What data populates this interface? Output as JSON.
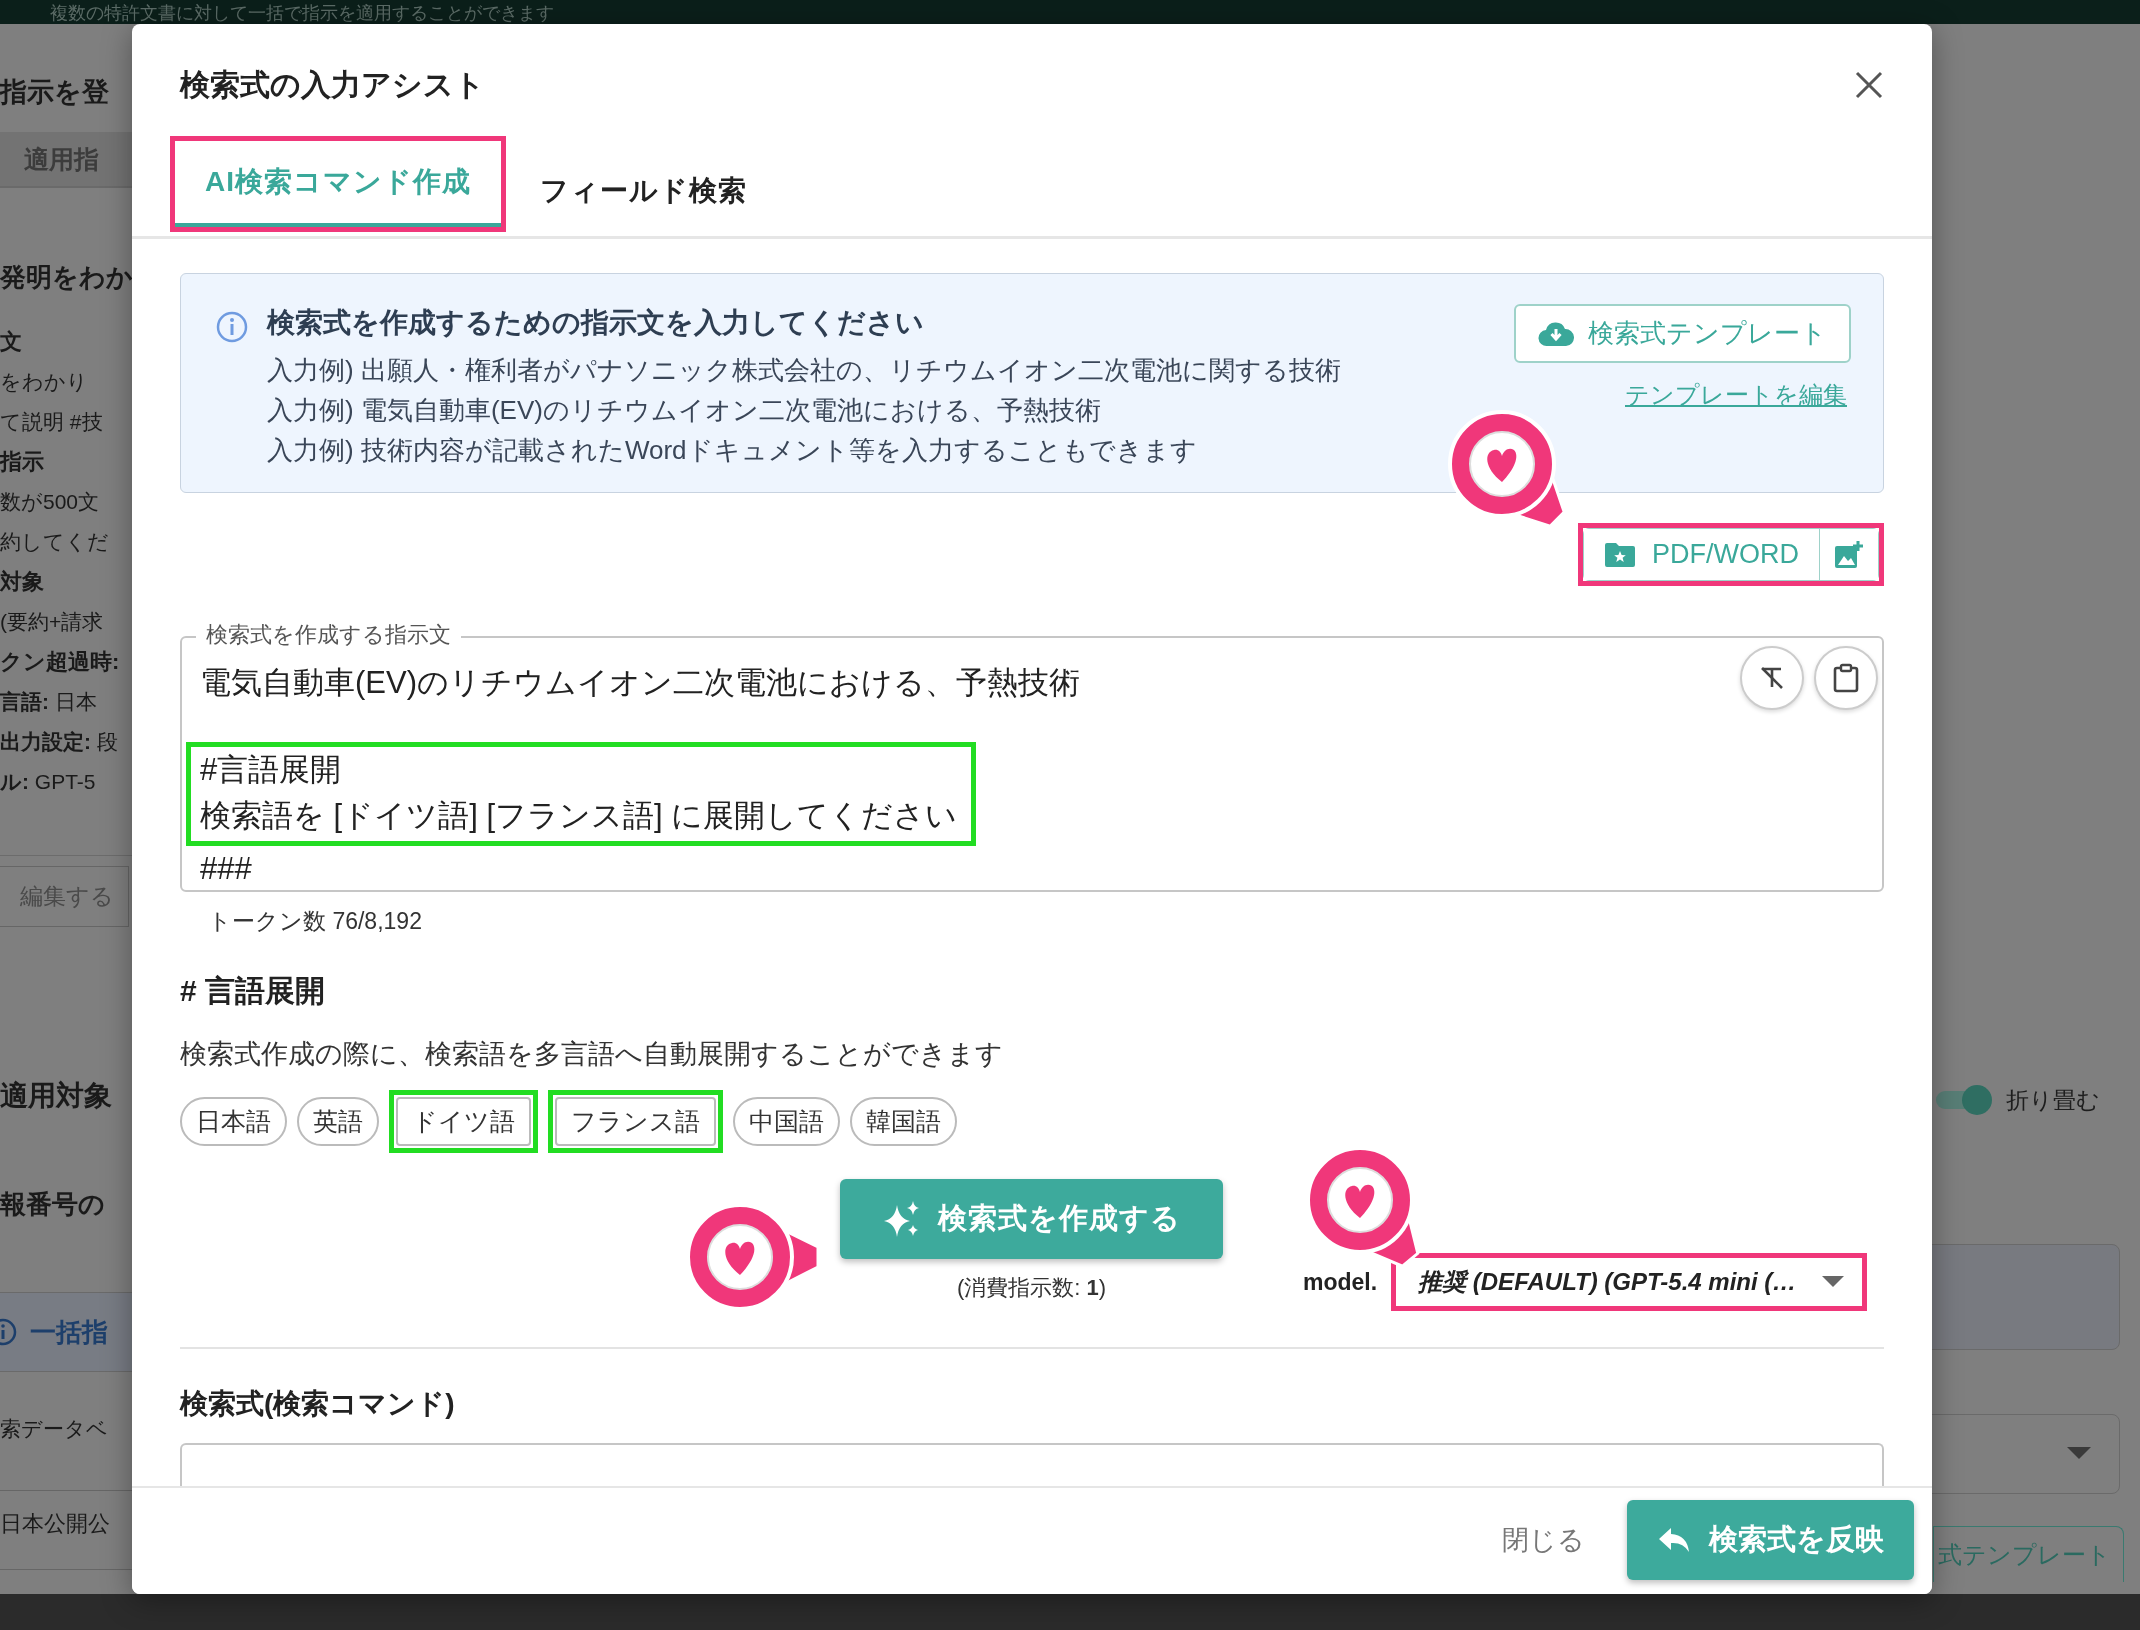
{
  "top_bar": {
    "text": "複数の特許文書に対して一括で指示を適用することができます"
  },
  "background": {
    "left": [
      {
        "kind": "title",
        "text": "指示を登"
      },
      {
        "kind": "tab",
        "text": "適用指"
      },
      {
        "kind": "heading",
        "text": "発明をわか"
      },
      {
        "kind": "bold",
        "text": "文"
      },
      {
        "kind": "text",
        "text": "をわかり"
      },
      {
        "kind": "text",
        "text": "て説明 #技"
      },
      {
        "kind": "bold",
        "text": "指示"
      },
      {
        "kind": "text",
        "text": "数が500文"
      },
      {
        "kind": "text",
        "text": "約してくだ"
      },
      {
        "kind": "bold",
        "text": "対象"
      },
      {
        "kind": "text",
        "text": "(要約+請求"
      },
      {
        "kind": "bold",
        "text": "クン超過時:"
      },
      {
        "kind": "text",
        "text": "**言語:** 日本"
      },
      {
        "kind": "text",
        "text": "**出力設定:** 段"
      },
      {
        "kind": "text",
        "text": "**ル:** GPT-5"
      },
      {
        "kind": "button",
        "text": "編集する"
      },
      {
        "kind": "section",
        "text": "適用対象"
      },
      {
        "kind": "heading",
        "text": "報番号の"
      },
      {
        "kind": "info",
        "text": "一括指"
      },
      {
        "kind": "text",
        "text": "索データベ"
      },
      {
        "kind": "value",
        "text": "日本公開公"
      }
    ],
    "right": {
      "toggle": {
        "label": "折り畳む",
        "on": true
      },
      "button": "式テンプレート"
    }
  },
  "dialog": {
    "title": "検索式の入力アシスト",
    "tabs": [
      {
        "label": "AI検索コマンド作成",
        "selected": true,
        "highlighted": true
      },
      {
        "label": "フィールド検索",
        "selected": false,
        "highlighted": false
      }
    ],
    "info": {
      "heading": "検索式を作成するための指示文を入力してください",
      "lines": [
        "入力例) 出願人・権利者がパナソニック株式会社の、リチウムイオン二次電池に関する技術",
        "入力例) 電気自動車(EV)のリチウムイオン二次電池における、予熱技術",
        "入力例) 技術内容が記載されたWordドキュメント等を入力することもできます"
      ],
      "template_button": "検索式テンプレート",
      "edit_link": "テンプレートを編集"
    },
    "upload": {
      "button": "PDF/WORD",
      "highlighted": true
    },
    "instruction": {
      "label": "検索式を作成する指示文",
      "blocks": [
        {
          "lines": [
            "電気自動車(EV)のリチウムイオン二次電池における、予熱技術"
          ],
          "highlighted": false,
          "blank_after": true
        },
        {
          "lines": [
            "#言語展開",
            "検索語を [ドイツ語] [フランス語] に展開してください"
          ],
          "highlighted": true,
          "blank_after": false
        },
        {
          "lines": [
            "###"
          ],
          "highlighted": false,
          "blank_after": false
        }
      ]
    },
    "token_count": "トークン数 76/8,192",
    "language": {
      "heading": "# 言語展開",
      "description": "検索式作成の際に、検索語を多言語へ自動展開することができます",
      "chips": [
        {
          "label": "日本語",
          "highlighted": false
        },
        {
          "label": "英語",
          "highlighted": false
        },
        {
          "label": "ドイツ語",
          "highlighted": true
        },
        {
          "label": "フランス語",
          "highlighted": true
        },
        {
          "label": "中国語",
          "highlighted": false
        },
        {
          "label": "韓国語",
          "highlighted": false
        }
      ]
    },
    "generate": {
      "button": "検索式を作成する",
      "cost": "(消費指示数: **1**)"
    },
    "model": {
      "label": "model.",
      "value": "推奨 (DEFAULT) (GPT-5.4 mini (…",
      "highlighted": true
    },
    "command": {
      "label": "検索式(検索コマンド)"
    },
    "footer": {
      "close": "閉じる",
      "apply": "検索式を反映"
    }
  }
}
